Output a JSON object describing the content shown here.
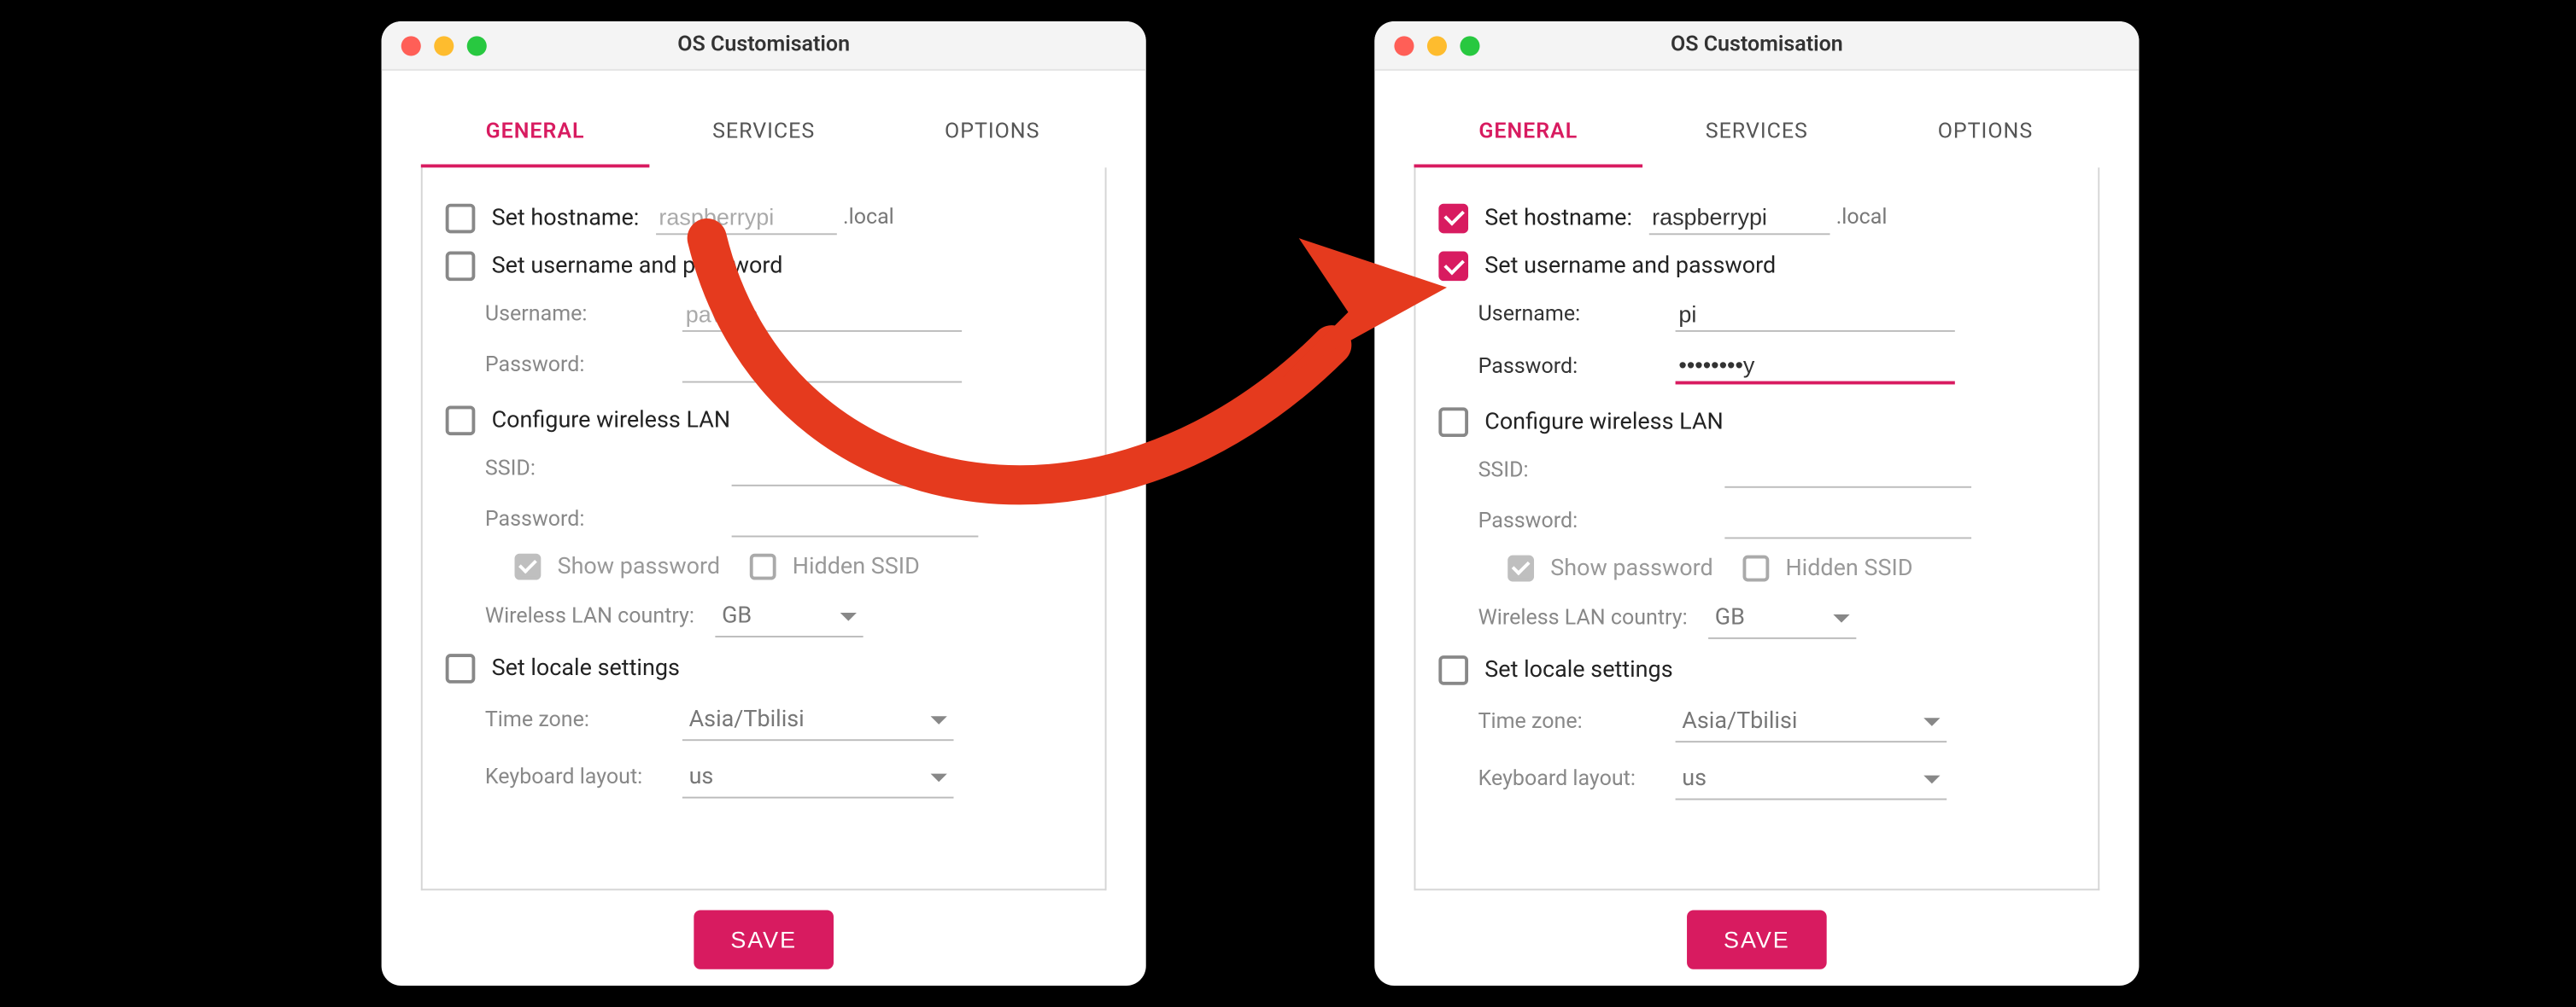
{
  "colors": {
    "accent": "#d81b60"
  },
  "left": {
    "title": "OS Customisation",
    "tabs": {
      "general": "GENERAL",
      "services": "SERVICES",
      "options": "OPTIONS"
    },
    "hostname": {
      "label": "Set hostname:",
      "checked": false,
      "value": "raspberrypi",
      "suffix": ".local"
    },
    "userpass": {
      "label": "Set username and password",
      "checked": false,
      "username_label": "Username:",
      "username_value": "pavliha",
      "password_label": "Password:",
      "password_value": ""
    },
    "wifi": {
      "label": "Configure wireless LAN",
      "checked": false,
      "ssid_label": "SSID:",
      "ssid_value": "",
      "password_label": "Password:",
      "password_value": "",
      "show_pw_label": "Show password",
      "show_pw_checked": true,
      "hidden_label": "Hidden SSID",
      "hidden_checked": false,
      "country_label": "Wireless LAN country:",
      "country_value": "GB"
    },
    "locale": {
      "label": "Set locale settings",
      "checked": false,
      "tz_label": "Time zone:",
      "tz_value": "Asia/Tbilisi",
      "kb_label": "Keyboard layout:",
      "kb_value": "us"
    },
    "save": "SAVE"
  },
  "right": {
    "title": "OS Customisation",
    "tabs": {
      "general": "GENERAL",
      "services": "SERVICES",
      "options": "OPTIONS"
    },
    "hostname": {
      "label": "Set hostname:",
      "checked": true,
      "value": "raspberrypi",
      "suffix": ".local"
    },
    "userpass": {
      "label": "Set username and password",
      "checked": true,
      "username_label": "Username:",
      "username_value": "pi",
      "password_label": "Password:",
      "password_value": "••••••••y"
    },
    "wifi": {
      "label": "Configure wireless LAN",
      "checked": false,
      "ssid_label": "SSID:",
      "ssid_value": "",
      "password_label": "Password:",
      "password_value": "",
      "show_pw_label": "Show password",
      "show_pw_checked": true,
      "hidden_label": "Hidden SSID",
      "hidden_checked": false,
      "country_label": "Wireless LAN country:",
      "country_value": "GB"
    },
    "locale": {
      "label": "Set locale settings",
      "checked": false,
      "tz_label": "Time zone:",
      "tz_value": "Asia/Tbilisi",
      "kb_label": "Keyboard layout:",
      "kb_value": "us"
    },
    "save": "SAVE"
  }
}
